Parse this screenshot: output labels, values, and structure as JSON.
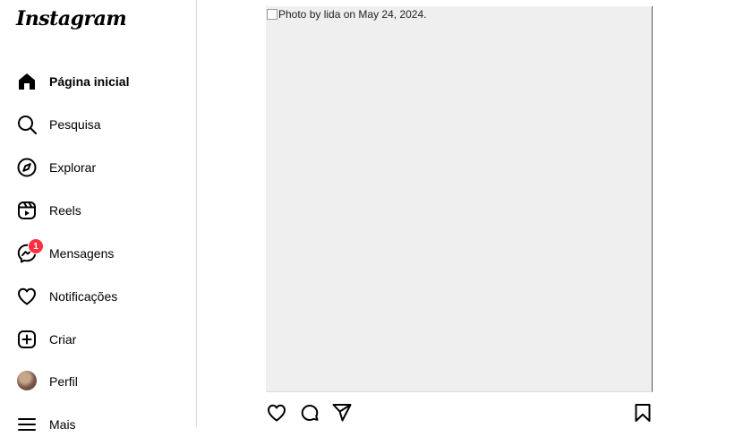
{
  "app": {
    "logo_text": "Instagram"
  },
  "sidebar": {
    "items": [
      {
        "label": "Página inicial",
        "icon": "home-icon"
      },
      {
        "label": "Pesquisa",
        "icon": "search-icon"
      },
      {
        "label": "Explorar",
        "icon": "compass-icon"
      },
      {
        "label": "Reels",
        "icon": "reels-icon"
      },
      {
        "label": "Mensagens",
        "icon": "messenger-icon",
        "badge": "1"
      },
      {
        "label": "Notificações",
        "icon": "heart-icon"
      },
      {
        "label": "Criar",
        "icon": "plus-square-icon"
      },
      {
        "label": "Perfil",
        "icon": "avatar"
      },
      {
        "label": "Mais",
        "icon": "menu-icon"
      }
    ]
  },
  "post": {
    "image_alt": "Photo by lida on May 24, 2024.",
    "actions": [
      "heart-icon",
      "comment-icon",
      "share-icon",
      "bookmark-icon"
    ]
  },
  "colors": {
    "badge": "#ff3040",
    "image_bg": "#efefef",
    "border": "#dbdbdb"
  }
}
